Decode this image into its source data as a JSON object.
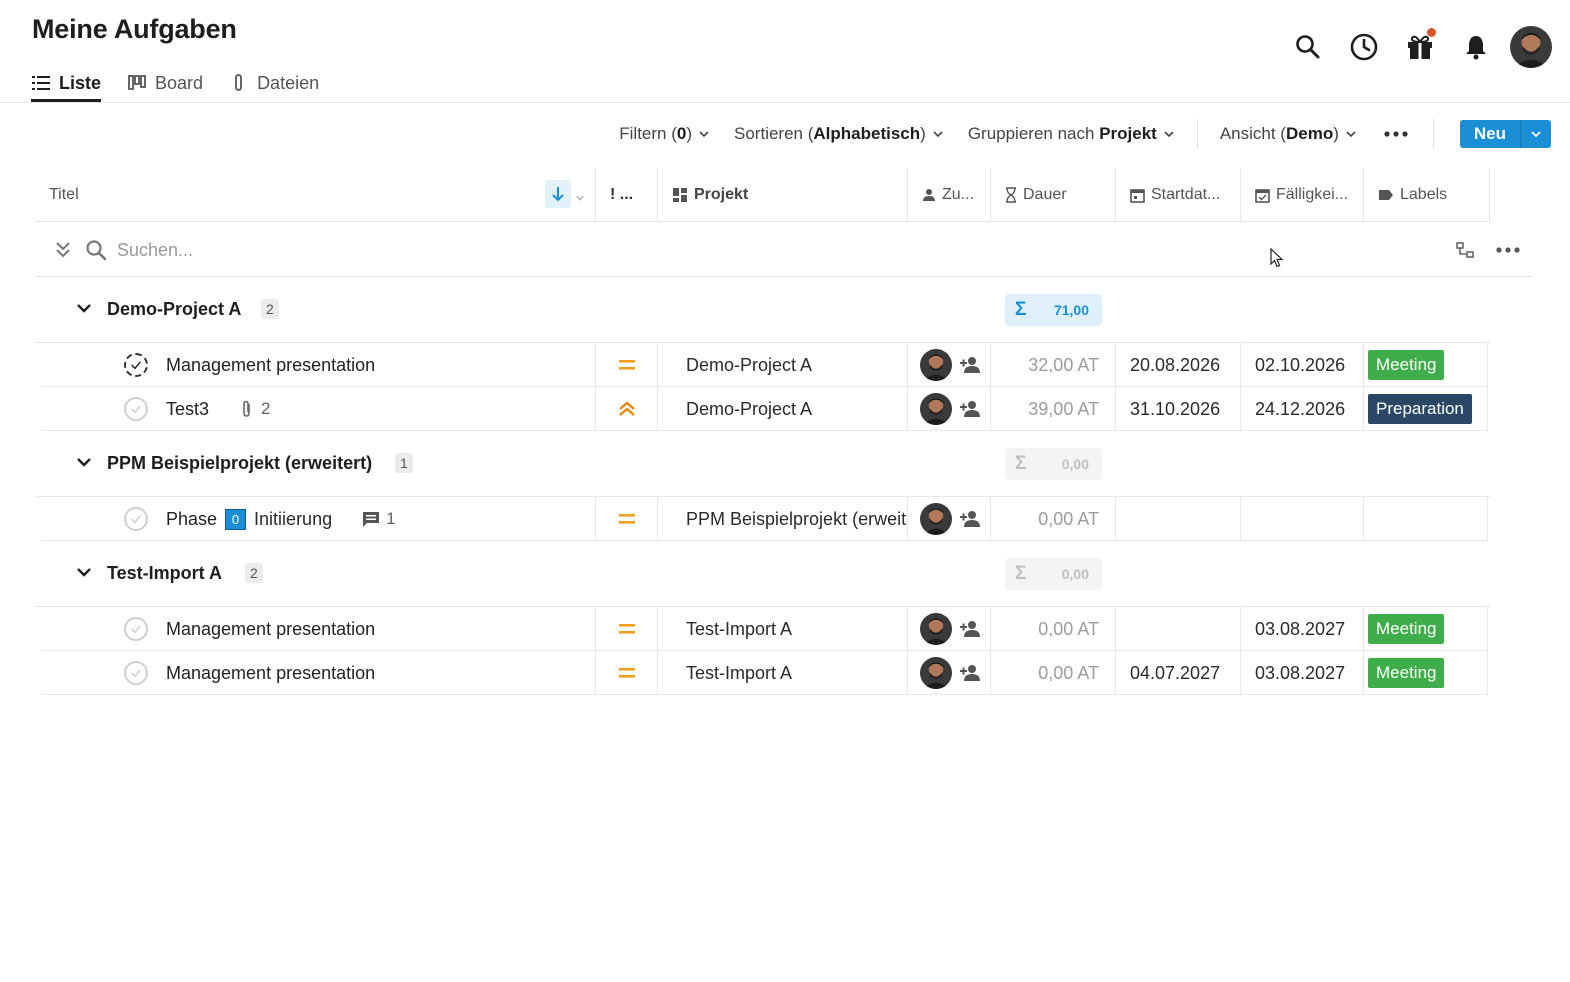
{
  "header": {
    "title": "Meine Aufgaben",
    "tabs": [
      {
        "label": "Liste",
        "icon": "list-icon",
        "active": true
      },
      {
        "label": "Board",
        "icon": "board-icon",
        "active": false
      },
      {
        "label": "Dateien",
        "icon": "paperclip-icon",
        "active": false
      }
    ],
    "icons": [
      "search-icon",
      "clock-icon",
      "gift-icon",
      "bell-icon"
    ],
    "notification_dot_color": "#d9562b"
  },
  "toolbar": {
    "filter_prefix": "Filtern (",
    "filter_count": "0",
    "filter_suffix": ")",
    "sort_prefix": "Sortieren (",
    "sort_value": "Alphabetisch",
    "sort_suffix": ")",
    "group_prefix": "Gruppieren nach ",
    "group_value": "Projekt",
    "view_prefix": "Ansicht (",
    "view_value": "Demo",
    "view_suffix": ")",
    "new_label": "Neu",
    "accent_color": "#1b8fd6"
  },
  "columns": {
    "title": "Titel",
    "priority": "! ...",
    "project": "Projekt",
    "assignee": "Zu...",
    "duration": "Dauer",
    "start": "Startdat...",
    "due": "Fälligkei...",
    "labels": "Labels"
  },
  "search": {
    "placeholder": "Suchen..."
  },
  "groups": [
    {
      "name": "Demo-Project A",
      "count": "2",
      "sum": "71,00",
      "sum_active": true,
      "rows": [
        {
          "title": "Management presentation",
          "priority": "medium",
          "project": "Demo-Project A",
          "duration": "32,00 AT",
          "start": "20.08.2026",
          "due": "02.10.2026",
          "label": "Meeting",
          "label_color": "#3dae4a",
          "check_style": "dashed"
        },
        {
          "title": "Test3",
          "attachments": "2",
          "priority": "high",
          "project": "Demo-Project A",
          "duration": "39,00 AT",
          "start": "31.10.2026",
          "due": "24.12.2026",
          "label": "Preparation",
          "label_color": "#2a4866",
          "check_style": "normal"
        }
      ]
    },
    {
      "name": "PPM Beispielprojekt (erweitert)",
      "count": "1",
      "sum": "0,00",
      "sum_active": false,
      "rows": [
        {
          "title_part1": "Phase",
          "phase_badge": "0",
          "title_part2": "Initiierung",
          "comments": "1",
          "priority": "medium",
          "project": "PPM Beispielprojekt (erweitert)",
          "duration": "0,00 AT",
          "start": "",
          "due": "",
          "label": ""
        }
      ]
    },
    {
      "name": "Test-Import A",
      "count": "2",
      "sum": "0,00",
      "sum_active": false,
      "rows": [
        {
          "title": "Management presentation",
          "priority": "medium",
          "project": "Test-Import A",
          "duration": "0,00 AT",
          "start": "",
          "due": "03.08.2027",
          "label": "Meeting",
          "label_color": "#3dae4a"
        },
        {
          "title": "Management presentation",
          "priority": "medium",
          "project": "Test-Import A",
          "duration": "0,00 AT",
          "start": "04.07.2027",
          "due": "03.08.2027",
          "label": "Meeting",
          "label_color": "#3dae4a"
        }
      ]
    }
  ],
  "sum_symbol": "Σ",
  "priority_color": "#f0a020"
}
